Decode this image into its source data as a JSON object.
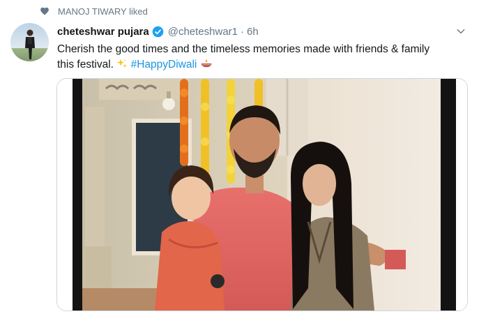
{
  "social_context": {
    "text": "MANOJ TIWARY liked",
    "icon": "heart-icon"
  },
  "tweet": {
    "display_name": "cheteshwar pujara",
    "verified": true,
    "handle": "@cheteshwar1",
    "separator": "·",
    "time": "6h",
    "text": "Cherish the good times and the timeless memories made with friends & family this festival.",
    "hashtag": "#HappyDiwali",
    "emojis": [
      "sparkles-icon",
      "diya-lamp-icon"
    ]
  },
  "colors": {
    "link_blue": "#1b95e0",
    "muted_gray": "#657786",
    "verified_blue": "#1da1f2",
    "card_border": "#ccd6dd"
  }
}
